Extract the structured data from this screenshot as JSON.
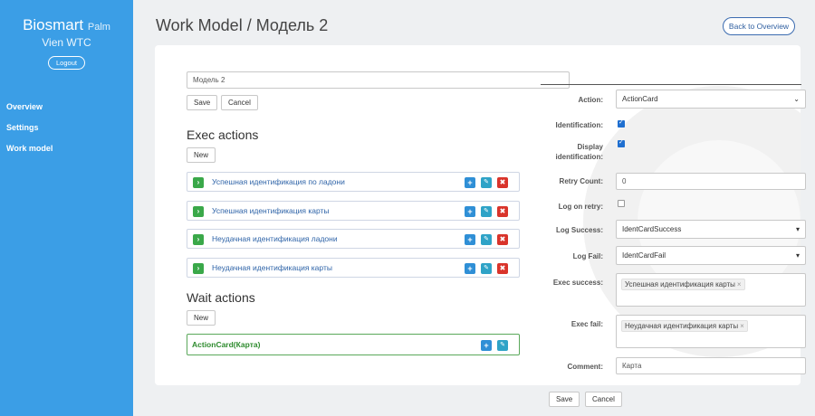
{
  "sidebar": {
    "brand": "Biosmart",
    "brand_sub": "Palm",
    "org": "Vien WTC",
    "logout": "Logout",
    "items": [
      {
        "label": "Overview"
      },
      {
        "label": "Settings"
      },
      {
        "label": "Work model"
      }
    ]
  },
  "header": {
    "title": "Work Model / Модель 2",
    "back_label": "Back to Overview"
  },
  "model": {
    "name_value": "Модель 2",
    "save_label": "Save",
    "cancel_label": "Cancel"
  },
  "exec_actions": {
    "title": "Exec actions",
    "new_label": "New",
    "items": [
      {
        "label": "Успешная идентификация по ладони"
      },
      {
        "label": "Успешная идентификация карты"
      },
      {
        "label": "Неудачная идентификация ладони"
      },
      {
        "label": "Неудачная идентификация карты"
      }
    ]
  },
  "wait_actions": {
    "title": "Wait actions",
    "new_label": "New",
    "items": [
      {
        "label": "ActionCard(Карта)"
      }
    ]
  },
  "form": {
    "action_label": "Action:",
    "action_value": "ActionCard",
    "identification_label": "Identification:",
    "identification_checked": true,
    "display_identification_label_1": "Display",
    "display_identification_label_2": "identification:",
    "display_identification_checked": true,
    "retry_count_label": "Retry Count:",
    "retry_count_value": "0",
    "log_on_retry_label": "Log on retry:",
    "log_on_retry_checked": false,
    "log_success_label": "Log Success:",
    "log_success_value": "IdentCardSuccess",
    "log_fail_label": "Log Fail:",
    "log_fail_value": "IdentCardFail",
    "exec_success_label": "Exec success:",
    "exec_success_tag": "Успешная идентификация карты",
    "exec_fail_label": "Exec fail:",
    "exec_fail_tag": "Неудачная идентификация карты",
    "comment_label": "Comment:",
    "comment_value": "Карта",
    "save_label": "Save",
    "cancel_label": "Cancel"
  },
  "colors": {
    "sidebar": "#3b9ee6",
    "play": "#3aa849",
    "add": "#2f8fd6",
    "edit": "#2fa3c7",
    "delete": "#d9342b"
  }
}
